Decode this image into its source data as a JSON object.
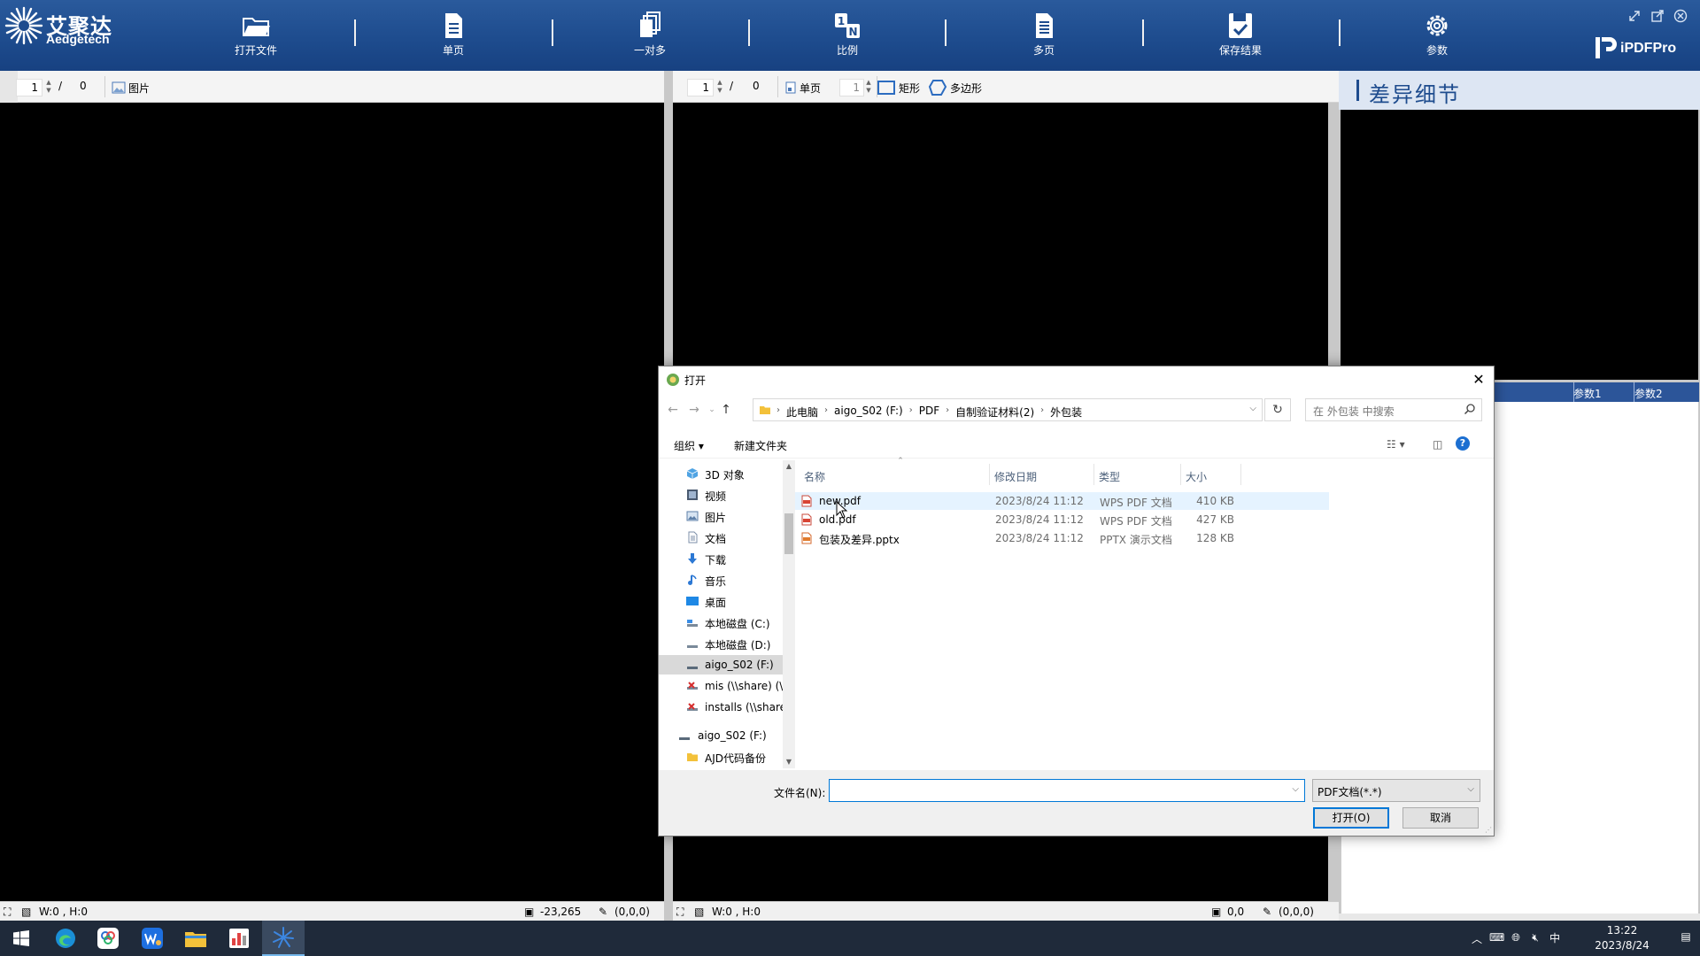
{
  "app": {
    "logo_cn": "艾聚达",
    "logo_en": "Aedgetech",
    "brand": "iPDFPro",
    "toolbar": [
      {
        "label": "打开文件",
        "icon": "folder-open-icon"
      },
      {
        "label": "单页",
        "icon": "single-page-icon"
      },
      {
        "label": "一对多",
        "icon": "one-to-many-icon"
      },
      {
        "label": "比例",
        "icon": "ratio-icon"
      },
      {
        "label": "多页",
        "icon": "multi-page-icon"
      },
      {
        "label": "保存结果",
        "icon": "save-result-icon"
      },
      {
        "label": "参数",
        "icon": "gear-icon"
      }
    ]
  },
  "left_strip": {
    "page": "1",
    "slash": "/",
    "total": "0",
    "image_label": "图片"
  },
  "right_strip": {
    "page": "1",
    "slash": "/",
    "total": "0",
    "single_label": "单页",
    "single_value": "1",
    "rect_label": "矩形",
    "poly_label": "多边形"
  },
  "diff": {
    "title": "差异细节",
    "col1": "参数1",
    "col2": "参数2"
  },
  "status_left": {
    "size": "W:0 , H:0",
    "coord": "-23,265",
    "color": "(0,0,0)"
  },
  "status_right": {
    "size": "W:0 , H:0",
    "coord": "0,0",
    "color": "(0,0,0)"
  },
  "dialog": {
    "title": "打开",
    "breadcrumbs": [
      "此电脑",
      "aigo_S02 (F:)",
      "PDF",
      "自制验证材料(2)",
      "外包装"
    ],
    "search_placeholder": "在 外包装 中搜索",
    "organize": "组织 ▾",
    "new_folder": "新建文件夹",
    "nav_items": [
      {
        "label": "3D 对象",
        "icon": "3d-objects-icon"
      },
      {
        "label": "视频",
        "icon": "video-icon"
      },
      {
        "label": "图片",
        "icon": "pictures-icon"
      },
      {
        "label": "文档",
        "icon": "documents-icon"
      },
      {
        "label": "下载",
        "icon": "download-icon"
      },
      {
        "label": "音乐",
        "icon": "music-icon"
      },
      {
        "label": "桌面",
        "icon": "desktop-icon"
      },
      {
        "label": "本地磁盘 (C:)",
        "icon": "drive-icon"
      },
      {
        "label": "本地磁盘 (D:)",
        "icon": "drive-icon"
      },
      {
        "label": "aigo_S02 (F:)",
        "icon": "drive-icon"
      },
      {
        "label": "mis (\\\\share) (\\",
        "icon": "network-drive-icon"
      },
      {
        "label": "installs (\\\\share",
        "icon": "network-drive-icon"
      },
      {
        "label": "aigo_S02 (F:)",
        "icon": "drive-icon"
      },
      {
        "label": "AJD代码备份",
        "icon": "folder-icon"
      }
    ],
    "columns": {
      "name": "名称",
      "date": "修改日期",
      "type": "类型",
      "size": "大小"
    },
    "files": [
      {
        "name": "new.pdf",
        "date": "2023/8/24 11:12",
        "type": "WPS PDF 文档",
        "size": "410 KB",
        "icon": "pdf-file-icon"
      },
      {
        "name": "old.pdf",
        "date": "2023/8/24 11:12",
        "type": "WPS PDF 文档",
        "size": "427 KB",
        "icon": "pdf-file-icon"
      },
      {
        "name": "包装及差异.pptx",
        "date": "2023/8/24 11:12",
        "type": "PPTX 演示文档",
        "size": "128 KB",
        "icon": "pptx-file-icon"
      }
    ],
    "filename_label": "文件名(N):",
    "filename_value": "",
    "filetype": "PDF文档(*.*)",
    "open_btn": "打开(O)",
    "cancel_btn": "取消"
  },
  "taskbar": {
    "time": "13:22",
    "date": "2023/8/24",
    "ime": "中"
  }
}
